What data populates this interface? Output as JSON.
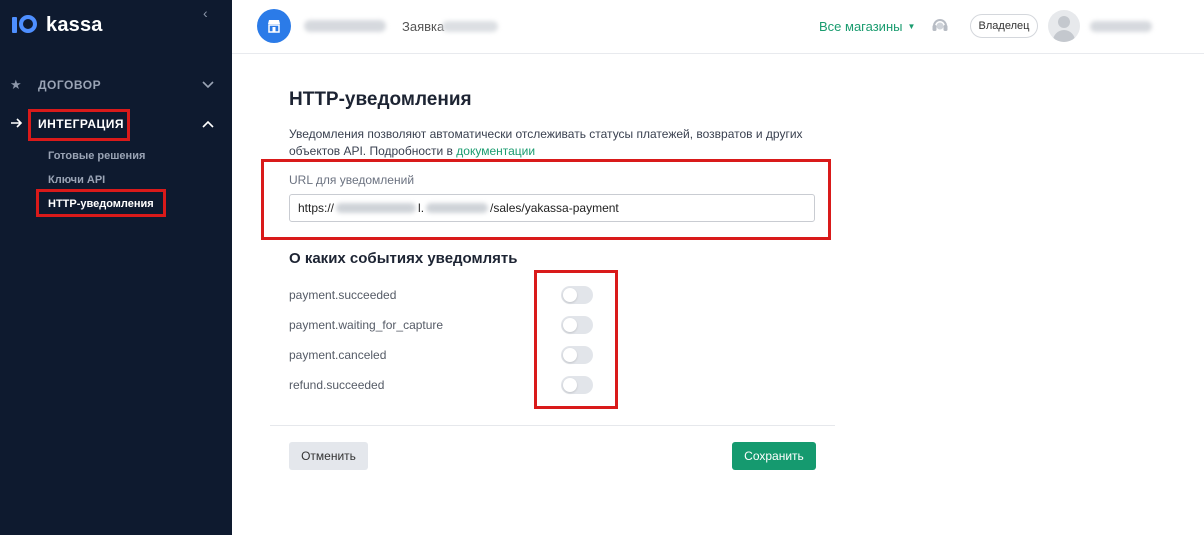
{
  "sidebar": {
    "logo_text": "kassa",
    "nav": [
      {
        "label": "ДОГОВОР"
      },
      {
        "label": "ИНТЕГРАЦИЯ"
      }
    ],
    "sub_items": [
      {
        "label": "Готовые решения"
      },
      {
        "label": "Ключи API"
      },
      {
        "label": "HTTP-уведомления"
      }
    ]
  },
  "header": {
    "request_label": "Заявка",
    "stores_label": "Все магазины",
    "owner_label": "Владелец"
  },
  "main": {
    "title": "HTTP-уведомления",
    "description": "Уведомления позволяют автоматически отслеживать статусы платежей, возвратов и других объектов API. Подробности в ",
    "docs_link": "документации",
    "url_label": "URL для уведомлений",
    "url_prefix": "https://",
    "url_mid": "l.",
    "url_suffix": "/sales/yakassa-payment",
    "events_title": "О каких событиях уведомлять",
    "events": [
      {
        "name": "payment.succeeded",
        "enabled": false
      },
      {
        "name": "payment.waiting_for_capture",
        "enabled": false
      },
      {
        "name": "payment.canceled",
        "enabled": false
      },
      {
        "name": "refund.succeeded",
        "enabled": false
      }
    ],
    "cancel_label": "Отменить",
    "save_label": "Сохранить"
  },
  "colors": {
    "sidebar_bg": "#0e1a2f",
    "accent_green": "#159a6f",
    "brand_blue": "#2b7be8",
    "highlight_red": "#d91a1a"
  }
}
